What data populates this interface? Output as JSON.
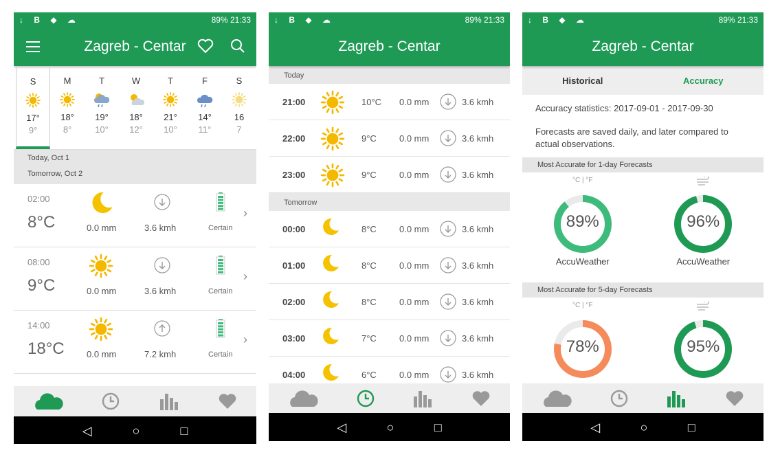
{
  "status": {
    "icons_left": "↓ B ◆ ☁",
    "battery": "89%",
    "time": "21:33"
  },
  "app": {
    "title": "Zagreb - Centar"
  },
  "screen1": {
    "days": [
      {
        "dn": "S",
        "icon": "sun",
        "hi": "17°",
        "lo": "9°"
      },
      {
        "dn": "M",
        "icon": "sun",
        "hi": "18°",
        "lo": "8°"
      },
      {
        "dn": "T",
        "icon": "cloud-rain",
        "hi": "19°",
        "lo": "10°"
      },
      {
        "dn": "W",
        "icon": "sun-cloud",
        "hi": "18°",
        "lo": "12°"
      },
      {
        "dn": "T",
        "icon": "sun",
        "hi": "21°",
        "lo": "10°"
      },
      {
        "dn": "F",
        "icon": "cloud-rain-gray",
        "hi": "14°",
        "lo": "11°"
      },
      {
        "dn": "S",
        "icon": "sun-faded",
        "hi": "16",
        "lo": "7"
      }
    ],
    "today_label": "Today, Oct 1",
    "tomorrow_label": "Tomorrow, Oct 2",
    "rows": [
      {
        "time": "02:00",
        "temp": "8°C",
        "icon": "moon",
        "precip": "0.0 mm",
        "wind_dir": "down",
        "wind": "3.6 kmh",
        "conf": "Certain"
      },
      {
        "time": "08:00",
        "temp": "9°C",
        "icon": "sun",
        "precip": "0.0 mm",
        "wind_dir": "down",
        "wind": "3.6 kmh",
        "conf": "Certain"
      },
      {
        "time": "14:00",
        "temp": "18°C",
        "icon": "sun",
        "precip": "0.0 mm",
        "wind_dir": "up",
        "wind": "7.2 kmh",
        "conf": "Certain"
      }
    ]
  },
  "screen2": {
    "today": "Today",
    "tomorrow": "Tomorrow",
    "today_rows": [
      {
        "t": "21:00",
        "icon": "sun",
        "temp": "10°C",
        "mm": "0.0 mm",
        "wind": "3.6 kmh"
      },
      {
        "t": "22:00",
        "icon": "sun",
        "temp": "9°C",
        "mm": "0.0 mm",
        "wind": "3.6 kmh"
      },
      {
        "t": "23:00",
        "icon": "sun",
        "temp": "9°C",
        "mm": "0.0 mm",
        "wind": "3.6 kmh"
      }
    ],
    "tomorrow_rows": [
      {
        "t": "00:00",
        "icon": "moon",
        "temp": "8°C",
        "mm": "0.0 mm",
        "wind": "3.6 kmh"
      },
      {
        "t": "01:00",
        "icon": "moon",
        "temp": "8°C",
        "mm": "0.0 mm",
        "wind": "3.6 kmh"
      },
      {
        "t": "02:00",
        "icon": "moon",
        "temp": "8°C",
        "mm": "0.0 mm",
        "wind": "3.6 kmh"
      },
      {
        "t": "03:00",
        "icon": "moon",
        "temp": "7°C",
        "mm": "0.0 mm",
        "wind": "3.6 kmh"
      },
      {
        "t": "04:00",
        "icon": "moon",
        "temp": "6°C",
        "mm": "0.0 mm",
        "wind": "3.6 kmh"
      }
    ]
  },
  "screen3": {
    "tab_historical": "Historical",
    "tab_accuracy": "Accuracy",
    "stats_line": "Accuracy statistics: 2017-09-01 - 2017-09-30",
    "desc": "Forecasts are saved daily, and later compared to actual observations.",
    "hdr1": "Most Accurate for 1-day Forecasts",
    "hdr2": "Most Accurate for 5-day Forecasts",
    "temp_unit_label": "°C  |  °F",
    "one_day": [
      {
        "pct": 89,
        "label": "89%",
        "source": "AccuWeather",
        "color": "#3dbb7a"
      },
      {
        "pct": 96,
        "label": "96%",
        "source": "AccuWeather",
        "color": "#1f9a55"
      }
    ],
    "five_day": [
      {
        "pct": 78,
        "label": "78%",
        "color": "#f58a5a"
      },
      {
        "pct": 95,
        "label": "95%",
        "color": "#1f9a55"
      }
    ]
  },
  "colors": {
    "green": "#1f9a55",
    "sun": "#f5b800",
    "moon": "#f5c200"
  }
}
